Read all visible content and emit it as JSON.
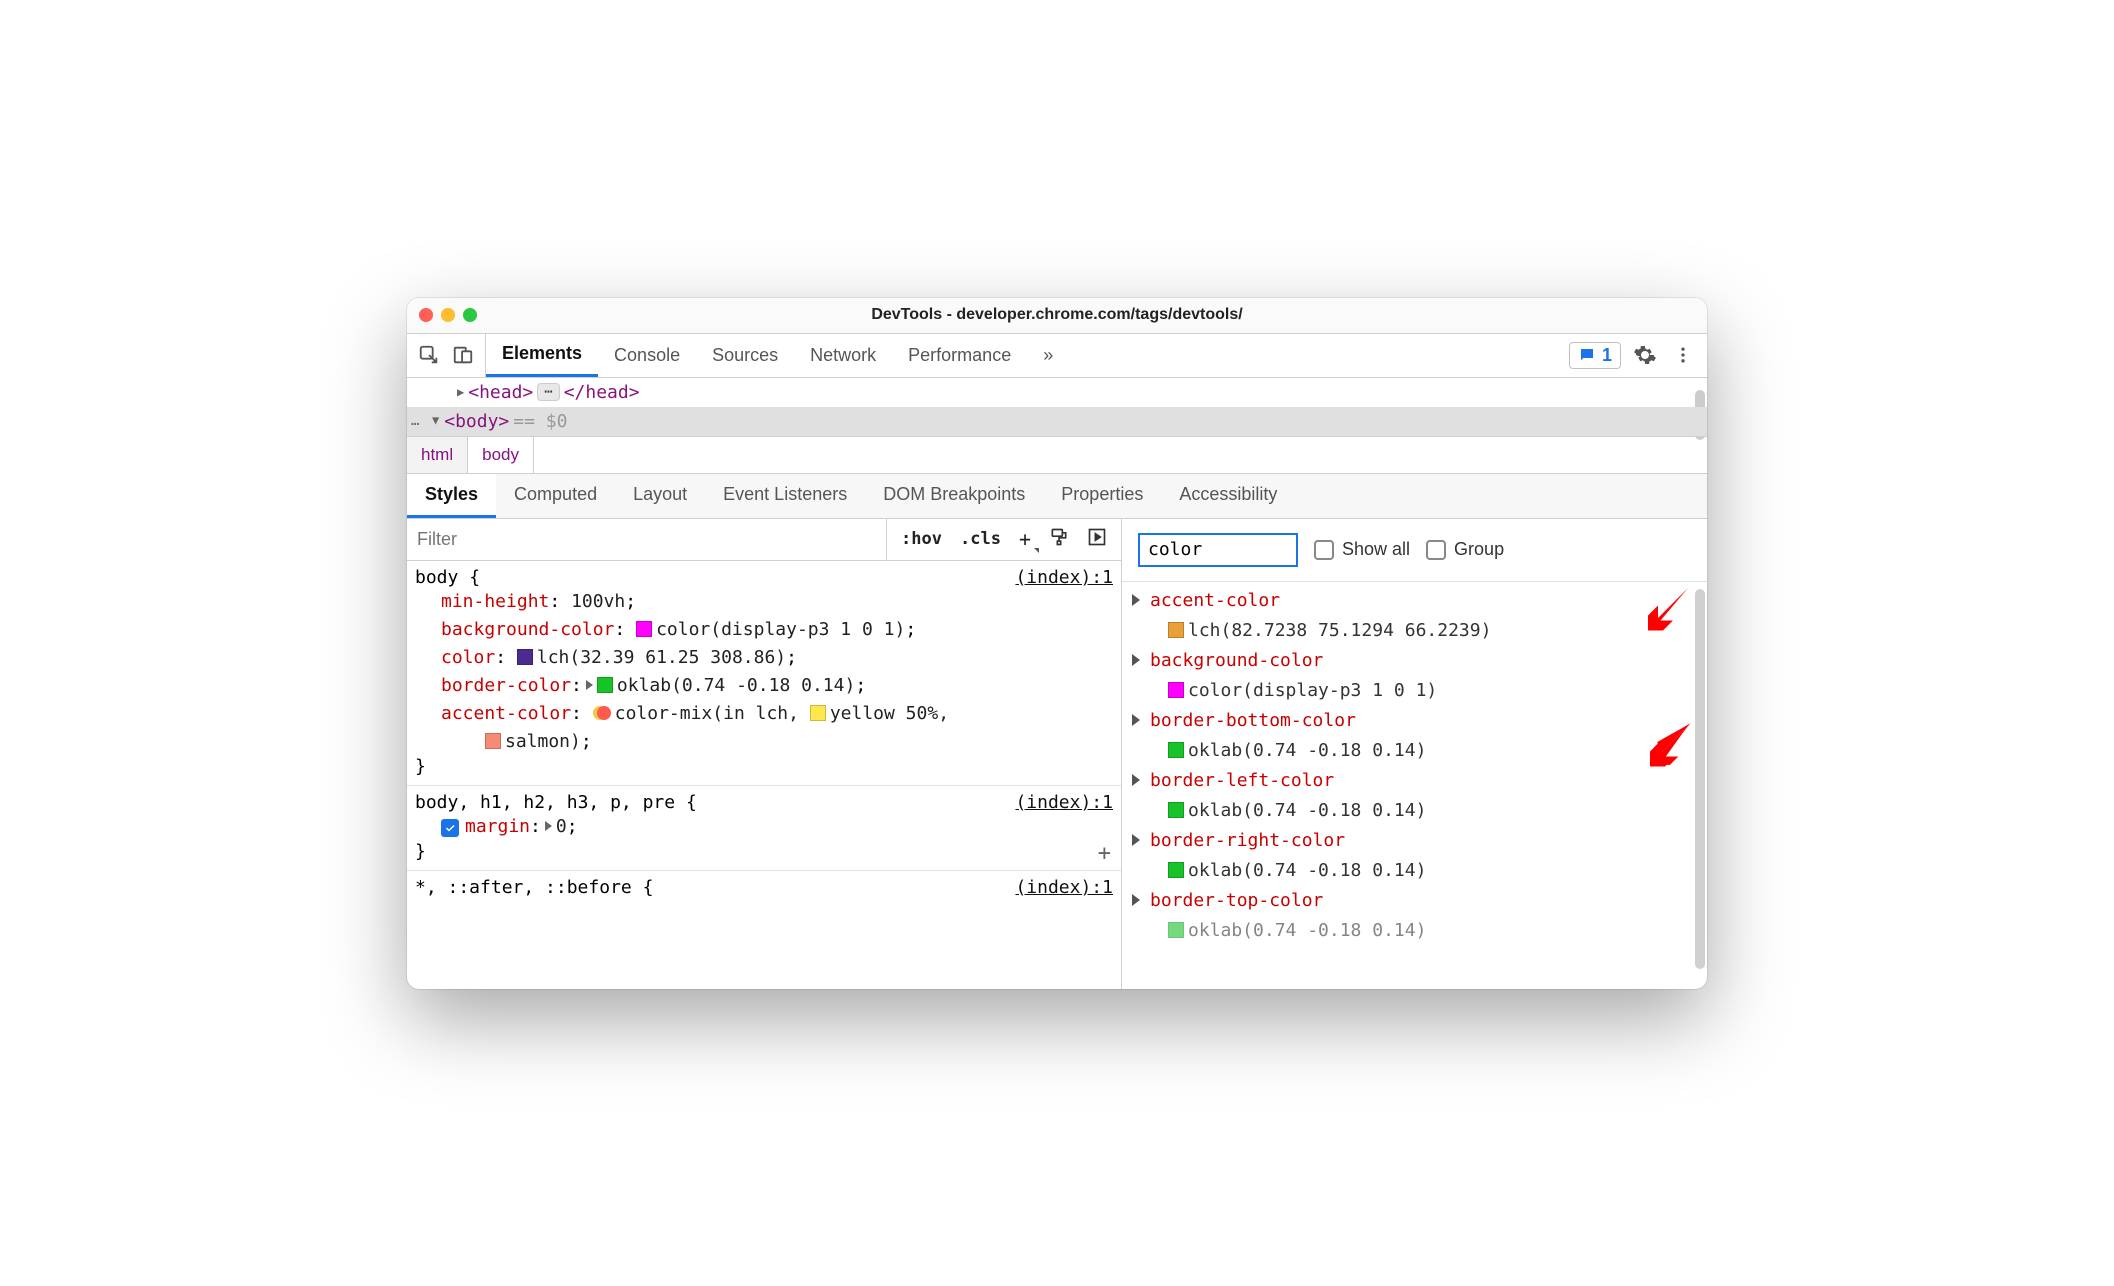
{
  "window_title": "DevTools - developer.chrome.com/tags/devtools/",
  "toolbar": {
    "tabs": [
      "Elements",
      "Console",
      "Sources",
      "Network",
      "Performance"
    ],
    "active_tab": "Elements",
    "overflow": "»",
    "messages_count": "1"
  },
  "dom": {
    "head_open": "<head>",
    "head_close": "</head>",
    "ellipsis": "⋯",
    "body_open": "<body>",
    "selected_suffix": "== $0",
    "more_dots": "…"
  },
  "crumbs": [
    "html",
    "body"
  ],
  "subtabs": [
    "Styles",
    "Computed",
    "Layout",
    "Event Listeners",
    "DOM Breakpoints",
    "Properties",
    "Accessibility"
  ],
  "active_subtab": "Styles",
  "filter": {
    "placeholder": "Filter",
    "hov": ":hov",
    "cls": ".cls",
    "plus": "+"
  },
  "rules": [
    {
      "selector_main": "body",
      "selector_dim": "",
      "source": "(index):1",
      "decls": [
        {
          "prop": "min-height",
          "val": "100vh",
          "swatch": null,
          "tri": false,
          "mix": false
        },
        {
          "prop": "background-color",
          "val": "color(display-p3 1 0 1)",
          "swatch": "magenta",
          "tri": false,
          "mix": false
        },
        {
          "prop": "color",
          "val": "lch(32.39 61.25 308.86)",
          "swatch": "purple",
          "tri": false,
          "mix": false
        },
        {
          "prop": "border-color",
          "val": "oklab(0.74 -0.18 0.14)",
          "swatch": "green",
          "tri": true,
          "mix": false
        },
        {
          "prop": "accent-color",
          "val_prefix": "color-mix(in lch,",
          "val_mid": "yellow 50%",
          "val_suffix": ",",
          "val_line2_swatch": "salmon",
          "val_line2": "salmon)",
          "swatch": null,
          "tri": false,
          "mix": true,
          "mid_swatch": "yellow"
        }
      ]
    },
    {
      "selector_main": "body",
      "selector_dim": ", h1, h2, h3, p, pre",
      "source": "(index):1",
      "decls": [
        {
          "prop": "margin",
          "val": "0",
          "swatch": null,
          "tri": true,
          "mix": false,
          "checked": true
        }
      ]
    },
    {
      "selector_main": "",
      "selector_dim": "*, ::after, ::before",
      "source": "(index):1",
      "decls": []
    }
  ],
  "computed": {
    "filter_value": "color",
    "show_all_label": "Show all",
    "group_label": "Group",
    "items": [
      {
        "name": "accent-color",
        "swatch": "orange",
        "value": "lch(82.7238 75.1294 66.2239)"
      },
      {
        "name": "background-color",
        "swatch": "magenta",
        "value": "color(display-p3 1 0 1)"
      },
      {
        "name": "border-bottom-color",
        "swatch": "green",
        "value": "oklab(0.74 -0.18 0.14)"
      },
      {
        "name": "border-left-color",
        "swatch": "green",
        "value": "oklab(0.74 -0.18 0.14)"
      },
      {
        "name": "border-right-color",
        "swatch": "green",
        "value": "oklab(0.74 -0.18 0.14)"
      },
      {
        "name": "border-top-color",
        "swatch": "green",
        "value": "oklab(0.74 -0.18 0.14)",
        "cut": true
      }
    ]
  }
}
